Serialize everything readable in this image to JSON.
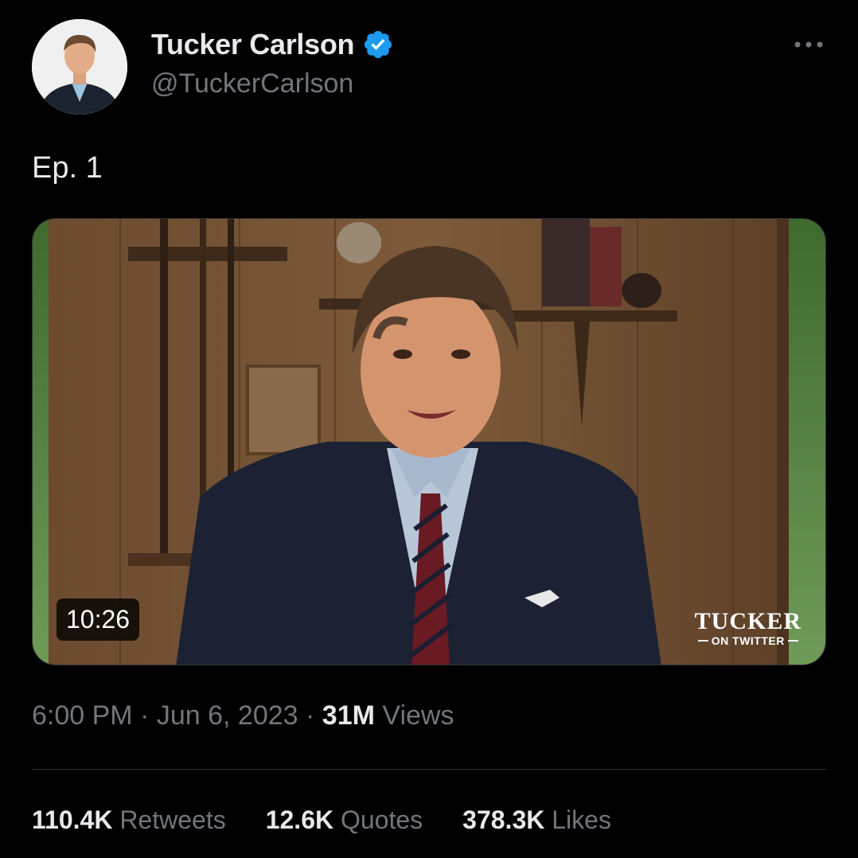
{
  "author": {
    "display_name": "Tucker Carlson",
    "handle": "@TuckerCarlson",
    "verified_color": "#1d9bf0"
  },
  "tweet": {
    "text": "Ep. 1"
  },
  "media": {
    "duration": "10:26",
    "watermark_title": "TUCKER",
    "watermark_subtitle": "ON TWITTER"
  },
  "meta": {
    "time": "6:00 PM",
    "date": "Jun 6, 2023",
    "separator": "·",
    "views_count": "31M",
    "views_label": "Views"
  },
  "stats": {
    "retweets_count": "110.4K",
    "retweets_label": "Retweets",
    "quotes_count": "12.6K",
    "quotes_label": "Quotes",
    "likes_count": "378.3K",
    "likes_label": "Likes"
  },
  "icons": {
    "more": "more-horizontal-icon",
    "verified": "verified-badge-icon"
  },
  "colors": {
    "background": "#000000",
    "primary_text": "#e7e9ea",
    "secondary_text": "#71767b",
    "divider": "#2f3336",
    "accent": "#1d9bf0"
  }
}
